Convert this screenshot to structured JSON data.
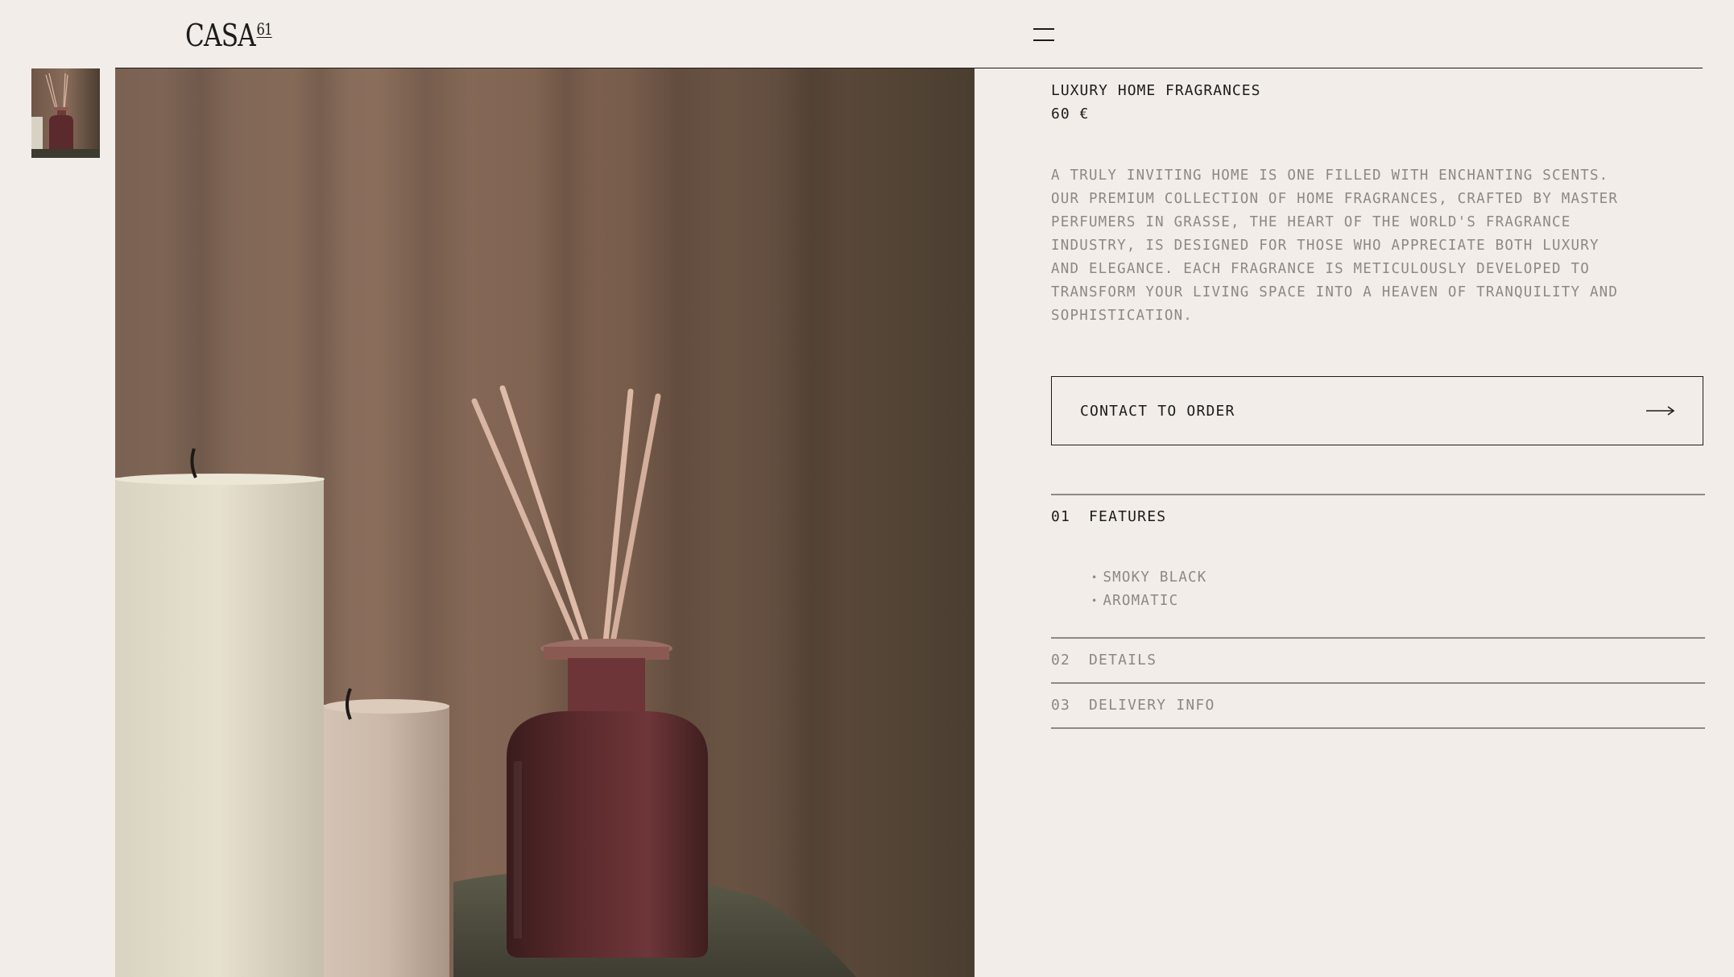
{
  "header": {
    "logo_text": "CASA",
    "logo_sup": "61",
    "menu_icon": "hamburger-menu-icon"
  },
  "product": {
    "title": "LUXURY HOME FRAGRANCES",
    "price": "60 €",
    "description": "A TRULY INVITING HOME IS ONE FILLED WITH ENCHANTING SCENTS. OUR PREMIUM COLLECTION OF HOME FRAGRANCES, CRAFTED BY MASTER PERFUMERS IN GRASSE, THE HEART OF THE WORLD'S FRAGRANCE INDUSTRY, IS DESIGNED FOR THOSE WHO APPRECIATE BOTH LUXURY AND ELEGANCE. EACH FRAGRANCE IS METICULOUSLY DEVELOPED TO TRANSFORM YOUR LIVING SPACE INTO A HEAVEN OF TRANQUILITY AND SOPHISTICATION."
  },
  "cta": {
    "label": "CONTACT TO ORDER",
    "icon": "arrow-right-icon"
  },
  "accordion": [
    {
      "number": "01",
      "label": "FEATURES",
      "open": true,
      "items": [
        "SMOKY BLACK",
        "AROMATIC"
      ]
    },
    {
      "number": "02",
      "label": "DETAILS",
      "open": false
    },
    {
      "number": "03",
      "label": "DELIVERY INFO",
      "open": false
    }
  ],
  "colors": {
    "background": "#f2ede8",
    "text": "#1c1c1c",
    "muted_text": "#8c8883",
    "diffuser_bottle": "#5a2a2c"
  }
}
